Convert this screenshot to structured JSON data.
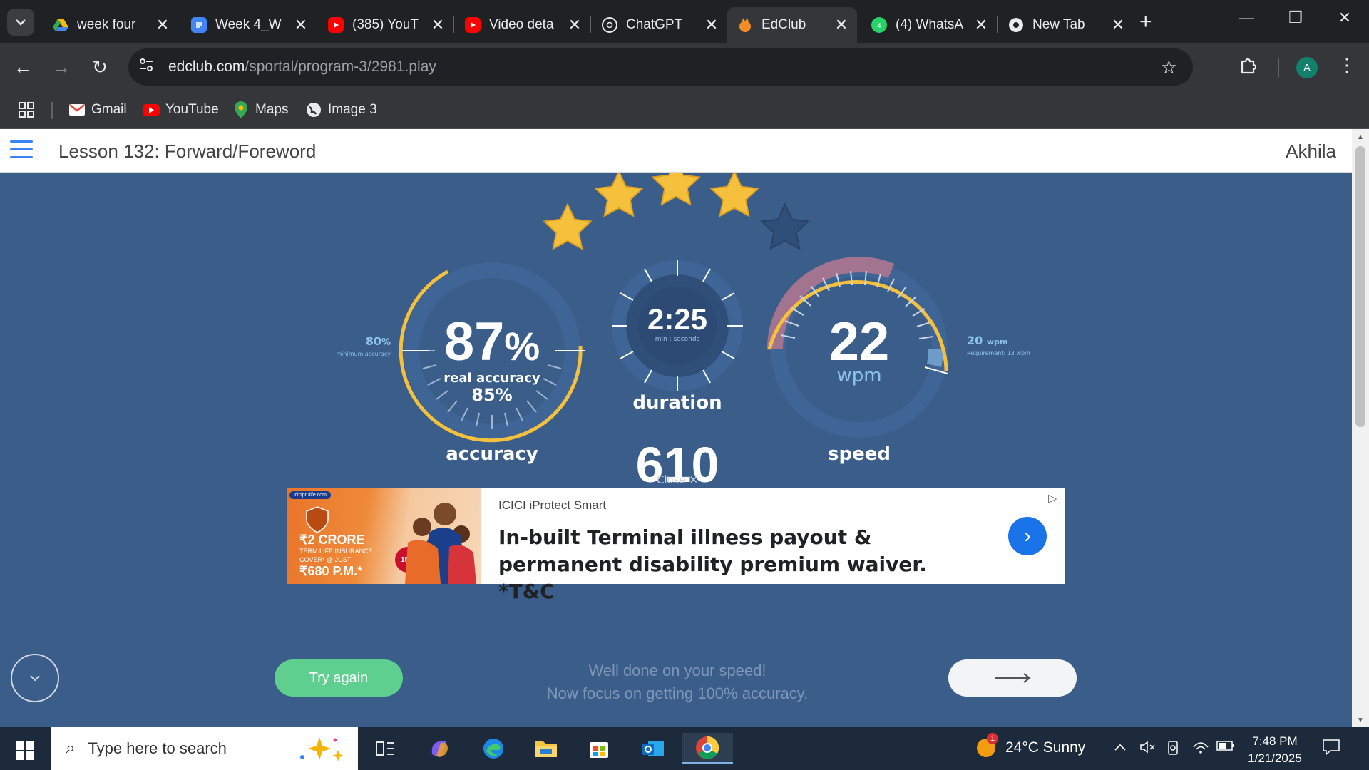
{
  "browser": {
    "tabs": [
      {
        "title": "week four",
        "icon": "google-drive-icon",
        "color": "#1a73e8"
      },
      {
        "title": "Week 4_W",
        "icon": "google-docs-icon",
        "color": "#4285f4"
      },
      {
        "title": "(385) YouT",
        "icon": "youtube-icon",
        "color": "#ff0000"
      },
      {
        "title": "Video deta",
        "icon": "youtube-icon",
        "color": "#ff0000"
      },
      {
        "title": "ChatGPT",
        "icon": "chatgpt-icon",
        "color": "#ffffff"
      },
      {
        "title": "EdClub",
        "icon": "edclub-icon",
        "color": "#f28c28"
      },
      {
        "title": "(4) WhatsA",
        "icon": "whatsapp-icon",
        "color": "#25d366"
      },
      {
        "title": "New Tab",
        "icon": "chrome-icon",
        "color": "#e8eaed"
      }
    ],
    "url_host": "edclub.com",
    "url_path": "/sportal/program-3/2981.play",
    "profile_initial": "A",
    "bookmarks": [
      {
        "label": "Gmail",
        "icon": "gmail-icon"
      },
      {
        "label": "YouTube",
        "icon": "youtube-icon"
      },
      {
        "label": "Maps",
        "icon": "maps-icon"
      },
      {
        "label": "Image 3",
        "icon": "globe-icon"
      }
    ]
  },
  "page": {
    "lesson_title": "Lesson 132: Forward/Foreword",
    "user_name": "Akhila"
  },
  "results": {
    "stars_earned": 4,
    "stars_total": 5,
    "accuracy": {
      "value": "87",
      "unit": "%",
      "label": "accuracy",
      "real_label": "real accuracy",
      "real_value": "85%",
      "minimum_value": "80",
      "minimum_unit": "%",
      "minimum_label": "minimum accuracy"
    },
    "duration": {
      "value": "2:25",
      "sub": "min : seconds",
      "label": "duration"
    },
    "speed": {
      "value": "22",
      "unit": "wpm",
      "label": "speed",
      "target_value": "20",
      "target_unit": "wpm",
      "requirement": "Requirement: 13 wpm"
    },
    "points": "610",
    "close_label": "Close"
  },
  "ad": {
    "sponsor": "ICICI iProtect Smart",
    "headline": "In-built Terminal illness payout & permanent disability premium waiver. *T&C",
    "image_domain": "iciciprulife.com",
    "image_line1": "₹2 CRORE",
    "image_line2": "TERM LIFE INSURANCE",
    "image_line3": "COVER* @ JUST",
    "image_line4": "₹680 P.M.*",
    "image_badge": "15%"
  },
  "actions": {
    "try_again": "Try again",
    "feedback_line1": "Well done on your speed!",
    "feedback_line2": "Now focus on getting 100% accuracy."
  },
  "taskbar": {
    "search_placeholder": "Type here to search",
    "weather": "24°C  Sunny",
    "weather_badge": "1",
    "time": "7:48 PM",
    "date": "1/21/2025"
  },
  "colors": {
    "page_bg": "#3a5d8a",
    "gauge_ring": "#f5c03b",
    "star_earned": "#f5c03b",
    "star_empty": "#2f4e78",
    "try_again": "#5fcf8f"
  }
}
